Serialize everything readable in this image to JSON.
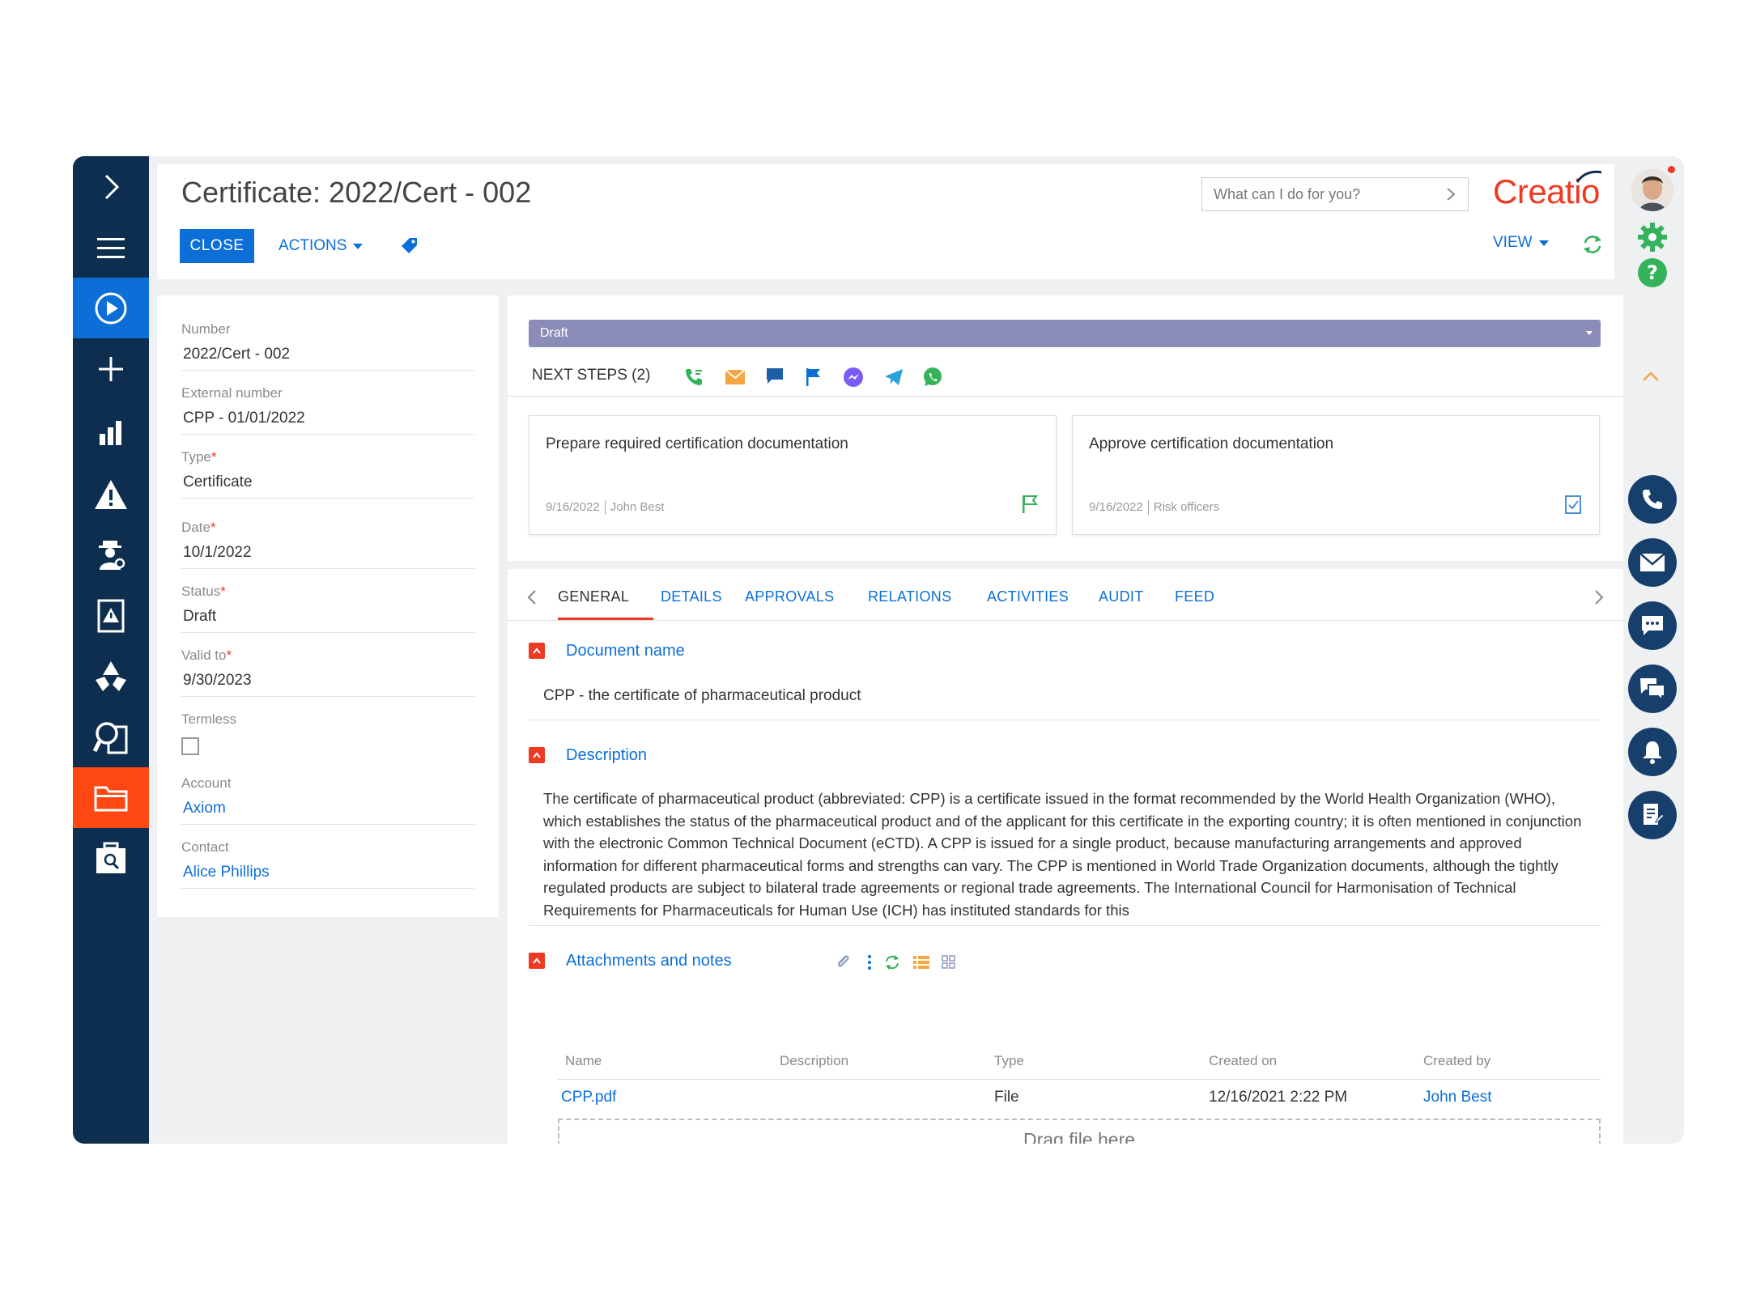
{
  "header": {
    "title": "Certificate: 2022/Cert - 002",
    "close_label": "CLOSE",
    "actions_label": "ACTIONS",
    "search_placeholder": "What can I do for you?",
    "logo_text": "Creatio",
    "view_label": "VIEW"
  },
  "form": {
    "number_label": "Number",
    "number_value": "2022/Cert - 002",
    "external_number_label": "External number",
    "external_number_value": "CPP - 01/01/2022",
    "type_label": "Type",
    "type_value": "Certificate",
    "date_label": "Date",
    "date_value": "10/1/2022",
    "status_label": "Status",
    "status_value": "Draft",
    "valid_to_label": "Valid to",
    "valid_to_value": "9/30/2023",
    "termless_label": "Termless",
    "account_label": "Account",
    "account_value": "Axiom",
    "contact_label": "Contact",
    "contact_value": "Alice Phillips",
    "required_mark": "*"
  },
  "dcm": {
    "stage": "Draft",
    "next_steps_label": "NEXT STEPS (2)",
    "cards": [
      {
        "title": "Prepare required certification documentation",
        "date": "9/16/2022",
        "owner": "John Best"
      },
      {
        "title": "Approve certification documentation",
        "date": "9/16/2022",
        "owner": "Risk officers"
      }
    ]
  },
  "tabs": [
    "GENERAL",
    "DETAILS",
    "APPROVALS",
    "RELATIONS",
    "ACTIVITIES",
    "AUDIT",
    "FEED"
  ],
  "general": {
    "document_name_title": "Document name",
    "document_name_value": "CPP - the certificate of pharmaceutical product",
    "description_title": "Description",
    "description_text": "The certificate of pharmaceutical product (abbreviated: CPP) is a certificate issued in the format recommended by the World Health Organization (WHO), which establishes the status of the pharmaceutical product and of the applicant for this certificate in the exporting country; it is often mentioned in conjunction with the electronic Common Technical Document (eCTD). A CPP is issued for a single product, because manufacturing arrangements and approved information for different pharmaceutical forms and strengths can vary. The CPP is mentioned in World Trade Organization documents, although the tightly regulated products are subject to bilateral trade agreements or regional trade agreements. The International Council for Harmonisation of Technical Requirements for Pharmaceuticals for Human Use (ICH) has instituted standards for this",
    "attachments_title": "Attachments and notes",
    "columns": [
      "Name",
      "Description",
      "Type",
      "Created on",
      "Created by"
    ],
    "rows": [
      {
        "name": "CPP.pdf",
        "description": "",
        "type": "File",
        "created_on": "12/16/2021 2:22 PM",
        "created_by": "John Best"
      }
    ],
    "dropzone_label": "Drag file here"
  },
  "colors": {
    "nav_bg": "#0d2e4e",
    "accent_blue": "#0c6fd8",
    "accent_orange": "#ff4713",
    "stage_bar": "#8b8db8",
    "brand_red": "#ee3a23"
  }
}
